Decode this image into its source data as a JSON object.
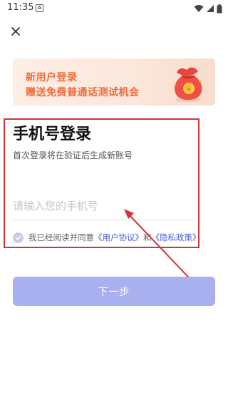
{
  "status_bar": {
    "time": "11:35",
    "notification_glyph": "A",
    "icons": [
      "wifi-icon",
      "signal-icon",
      "battery-icon"
    ]
  },
  "header": {
    "close_icon": "close-icon"
  },
  "banner": {
    "line1": "新用户登录",
    "line2": "赠送免费普通话测试机会",
    "icon": "money-bag-icon",
    "accent_color": "#f06c3a"
  },
  "login": {
    "title": "手机号登录",
    "subtitle": "首次登录将在验证后生成新账号",
    "phone_placeholder": "请输入您的手机号",
    "phone_value": ""
  },
  "agreement": {
    "checked": true,
    "text_prefix": "我已经阅读并同意",
    "user_agreement": "《用户协议》",
    "conjunction": "和",
    "privacy_policy": "《隐私政策》",
    "link_color": "#4a5fd6"
  },
  "actions": {
    "next_label": "下一步",
    "next_color": "#a9b0ef"
  },
  "annotation": {
    "color": "#d9313a"
  }
}
